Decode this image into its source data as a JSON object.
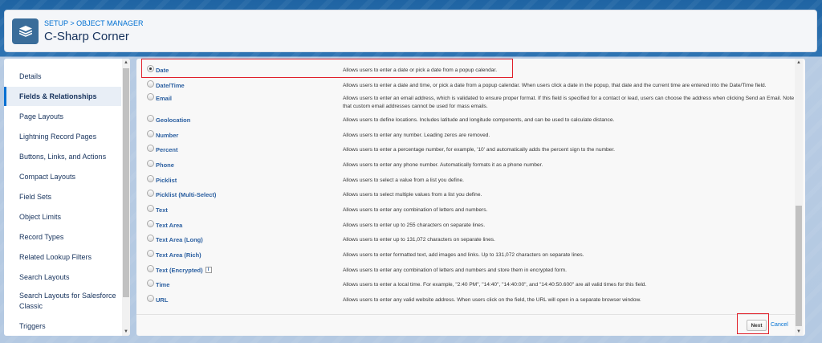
{
  "header": {
    "breadcrumb": "SETUP > OBJECT MANAGER",
    "title": "C-Sharp Corner"
  },
  "sidebar": {
    "items": [
      {
        "label": "Details"
      },
      {
        "label": "Fields & Relationships",
        "active": true
      },
      {
        "label": "Page Layouts"
      },
      {
        "label": "Lightning Record Pages"
      },
      {
        "label": "Buttons, Links, and Actions"
      },
      {
        "label": "Compact Layouts"
      },
      {
        "label": "Field Sets"
      },
      {
        "label": "Object Limits"
      },
      {
        "label": "Record Types"
      },
      {
        "label": "Related Lookup Filters"
      },
      {
        "label": "Search Layouts"
      },
      {
        "label": "Search Layouts for Salesforce Classic"
      },
      {
        "label": "Triggers"
      }
    ]
  },
  "field_types": [
    {
      "label": "Date",
      "selected": true,
      "desc": "Allows users to enter a date or pick a date from a popup calendar."
    },
    {
      "label": "Date/Time",
      "desc": "Allows users to enter a date and time, or pick a date from a popup calendar. When users click a date in the popup, that date and the current time are entered into the Date/Time field."
    },
    {
      "label": "Email",
      "desc": "Allows users to enter an email address, which is validated to ensure proper format. If this field is specified for a contact or lead, users can choose the address when clicking Send an Email. Note that custom email addresses cannot be used for mass emails."
    },
    {
      "label": "Geolocation",
      "desc": "Allows users to define locations. Includes latitude and longitude components, and can be used to calculate distance."
    },
    {
      "label": "Number",
      "desc": "Allows users to enter any number. Leading zeros are removed."
    },
    {
      "label": "Percent",
      "desc": "Allows users to enter a percentage number, for example, '10' and automatically adds the percent sign to the number."
    },
    {
      "label": "Phone",
      "desc": "Allows users to enter any phone number. Automatically formats it as a phone number."
    },
    {
      "label": "Picklist",
      "desc": "Allows users to select a value from a list you define."
    },
    {
      "label": "Picklist (Multi-Select)",
      "desc": "Allows users to select multiple values from a list you define."
    },
    {
      "label": "Text",
      "desc": "Allows users to enter any combination of letters and numbers."
    },
    {
      "label": "Text Area",
      "desc": "Allows users to enter up to 255 characters on separate lines."
    },
    {
      "label": "Text Area (Long)",
      "desc": "Allows users to enter up to 131,072 characters on separate lines."
    },
    {
      "label": "Text Area (Rich)",
      "desc": "Allows users to enter formatted text, add images and links. Up to 131,072 characters on separate lines."
    },
    {
      "label": "Text (Encrypted)",
      "info": "i",
      "desc": "Allows users to enter any combination of letters and numbers and store them in encrypted form."
    },
    {
      "label": "Time",
      "desc": "Allows users to enter a local time. For example, \"2:40 PM\", \"14:40\", \"14:40:00\", and \"14:40:50.600\" are all valid times for this field."
    },
    {
      "label": "URL",
      "desc": "Allows users to enter any valid website address. When users click on the field, the URL will open in a separate browser window."
    }
  ],
  "footer": {
    "next_label": "Next",
    "cancel_label": "Cancel"
  },
  "colors": {
    "accent": "#0070d2",
    "highlight": "#e0202a"
  }
}
